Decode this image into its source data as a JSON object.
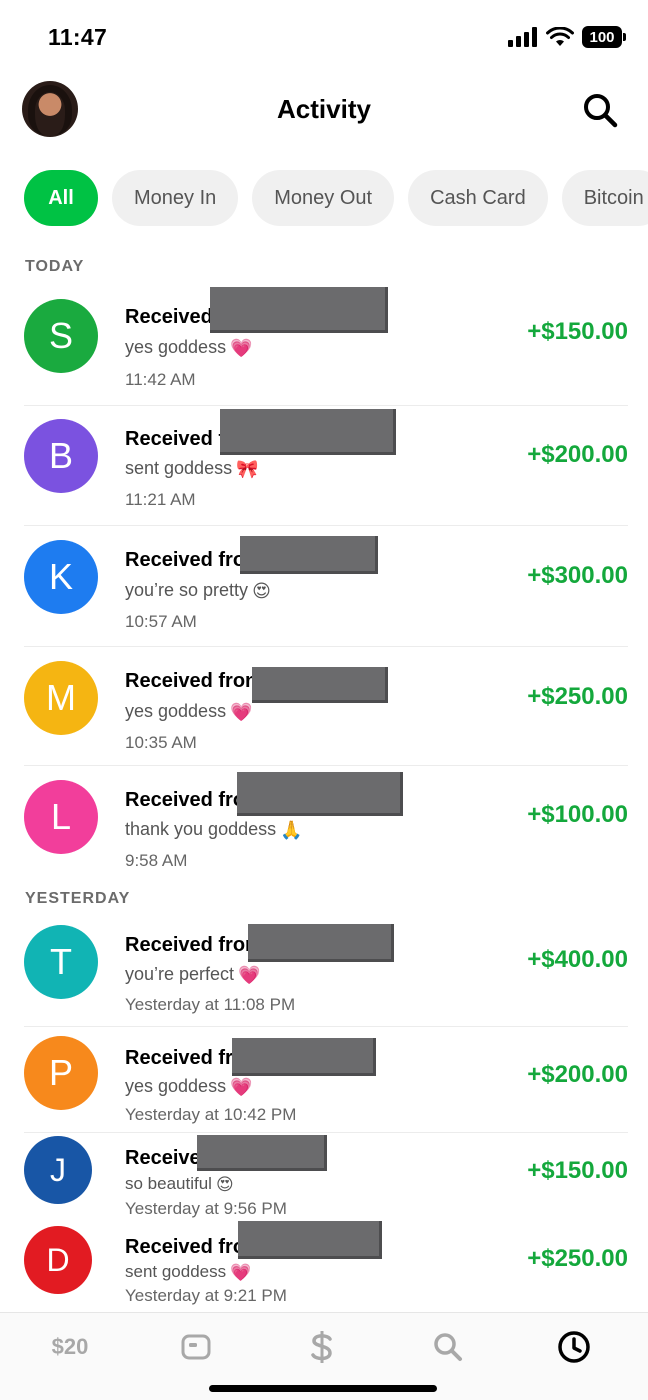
{
  "status_bar": {
    "time": "11:47",
    "battery": "100"
  },
  "header": {
    "title": "Activity"
  },
  "filters": [
    {
      "label": "All",
      "active": true
    },
    {
      "label": "Money In",
      "active": false
    },
    {
      "label": "Money Out",
      "active": false
    },
    {
      "label": "Cash Card",
      "active": false
    },
    {
      "label": "Bitcoin",
      "active": false
    }
  ],
  "sections": {
    "today": "TODAY",
    "yesterday": "YESTERDAY"
  },
  "transactions": [
    {
      "initial": "S",
      "color": "#1aaa3f",
      "title": "Received",
      "note": "yes goddess",
      "emoji": "pink-heart",
      "time": "11:42 AM",
      "amount": "+$150.00"
    },
    {
      "initial": "B",
      "color": "#7b52e0",
      "title": "Received f",
      "note": "sent goddess",
      "emoji": "ribbon-bow",
      "time": "11:21 AM",
      "amount": "+$200.00"
    },
    {
      "initial": "K",
      "color": "#1e7cf0",
      "title": "Received fro",
      "note": "you’re so pretty",
      "emoji": "heart-eyes",
      "time": "10:57 AM",
      "amount": "+$300.00"
    },
    {
      "initial": "M",
      "color": "#f5b512",
      "title": "Received fron",
      "note": "yes goddess",
      "emoji": "pink-heart",
      "time": "10:35 AM",
      "amount": "+$250.00"
    },
    {
      "initial": "L",
      "color": "#f23e9b",
      "title": "Received fro",
      "note": "thank you goddess",
      "emoji": "praying-hands",
      "time": "9:58 AM",
      "amount": "+$100.00"
    },
    {
      "initial": "T",
      "color": "#11b4b4",
      "title": "Received fror",
      "note": "you’re perfect",
      "emoji": "pink-heart",
      "time": "Yesterday at 11:08 PM",
      "amount": "+$400.00"
    },
    {
      "initial": "P",
      "color": "#f7891c",
      "title": "Received fr",
      "note": "yes goddess",
      "emoji": "pink-heart",
      "time": "Yesterday at 10:42 PM",
      "amount": "+$200.00"
    },
    {
      "initial": "J",
      "color": "#1856a6",
      "title": "Receive",
      "note": "so beautiful",
      "emoji": "heart-eyes",
      "time": "Yesterday at 9:56 PM",
      "amount": "+$150.00"
    },
    {
      "initial": "D",
      "color": "#e21b22",
      "title": "Received fro",
      "note": "sent goddess",
      "emoji": "pink-heart",
      "time": "Yesterday at 9:21 PM",
      "amount": "+$250.00"
    }
  ],
  "tab_bar": {
    "balance": "$20",
    "icons": [
      "card-icon",
      "dollar-icon",
      "search-icon",
      "clock-icon"
    ],
    "active": "clock-icon"
  },
  "colors": {
    "accent": "#00c244",
    "amount": "#14a83c"
  }
}
